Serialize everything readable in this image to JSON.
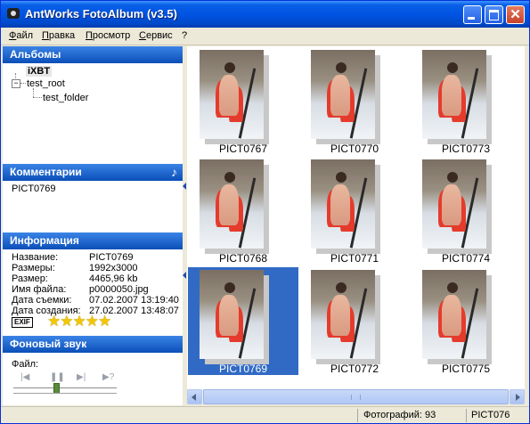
{
  "window": {
    "title": "AntWorks FotoAlbum (v3.5)"
  },
  "menu": [
    "Файл",
    "Правка",
    "Просмотр",
    "Сервис",
    "?"
  ],
  "albums": {
    "header": "Альбомы",
    "root_item": "iXBT",
    "child": "test_root",
    "grandchild": "test_folder"
  },
  "comments": {
    "header": "Комментарии",
    "text": "PICT0769",
    "icon": "music-note-icon"
  },
  "info": {
    "header": "Информация",
    "rows": [
      {
        "key": "Название:",
        "value": "PICT0769"
      },
      {
        "key": "Размеры:",
        "value": "1992x3000"
      },
      {
        "key": "Размер:",
        "value": "4465,96 kb"
      },
      {
        "key": "Имя файла:",
        "value": "p0000050.jpg"
      },
      {
        "key": "Дата съемки:",
        "value": "07.02.2007 13:19:40"
      },
      {
        "key": "Дата создания:",
        "value": "27.02.2007 13:48:07"
      }
    ],
    "exif_label": "EXIF",
    "rating": 5,
    "rating_max": 5
  },
  "sound": {
    "header": "Фоновый звук",
    "file_label": "Файл:",
    "buttons": [
      "prev-icon",
      "pause-icon",
      "next-icon",
      "random-icon"
    ]
  },
  "thumbnails": [
    {
      "caption": "PICT0767",
      "selected": false
    },
    {
      "caption": "PICT0770",
      "selected": false
    },
    {
      "caption": "PICT0773",
      "selected": false
    },
    {
      "caption": "PICT0768",
      "selected": false
    },
    {
      "caption": "PICT0771",
      "selected": false
    },
    {
      "caption": "PICT0774",
      "selected": false
    },
    {
      "caption": "PICT0769",
      "selected": true
    },
    {
      "caption": "PICT0772",
      "selected": false
    },
    {
      "caption": "PICT0775",
      "selected": false
    }
  ],
  "status": {
    "count_text": "Фотографий: 93",
    "current": "PICT076"
  },
  "colors": {
    "titlebar": "#0054e3",
    "section_header": "#0a4fb8",
    "selection": "#316ac5",
    "star": "#f2c700"
  }
}
